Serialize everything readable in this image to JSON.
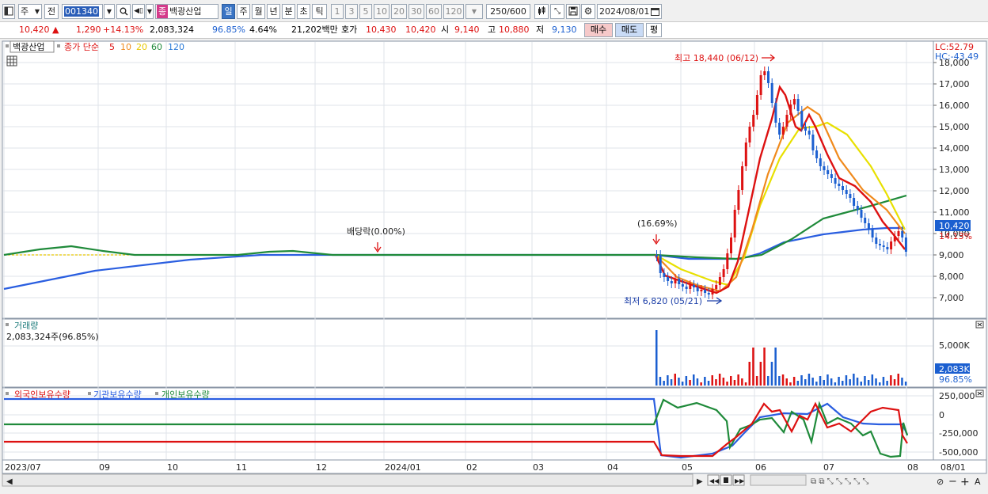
{
  "toolbar": {
    "period_tab": "주",
    "prev_label": "전",
    "stock_code": "001340",
    "stock_name": "백광산업",
    "name_badge": "종",
    "period_buttons": [
      "일",
      "주",
      "월",
      "년",
      "분",
      "초",
      "틱"
    ],
    "interval_buttons": [
      "1",
      "3",
      "5",
      "10",
      "20",
      "30",
      "60",
      "120"
    ],
    "count_display": "250",
    "count_max": "/600",
    "date_value": "2024/08/01"
  },
  "quote": {
    "price": "10,420",
    "arrow": "▲",
    "change": "1,290",
    "change_pct": "+14.13%",
    "volume": "2,083,324",
    "volume_ratio": "96.85%",
    "turnover": "4.64%",
    "amount": "21,202백만",
    "ask_label": "호가",
    "ask": "10,430",
    "bid": "10,420",
    "open_label": "시",
    "open": "9,140",
    "high_label": "고",
    "high": "10,880",
    "low_label": "저",
    "low": "9,130",
    "buy_label": "매수",
    "sell_label": "매도",
    "eval_label": "평"
  },
  "legend": {
    "name": "백광산업",
    "ma_label": "종가 단순",
    "ma": [
      {
        "p": "5",
        "color": "#dd1111"
      },
      {
        "p": "10",
        "color": "#f08a1c"
      },
      {
        "p": "20",
        "color": "#e8e000"
      },
      {
        "p": "60",
        "color": "#1f8a3a"
      },
      {
        "p": "120",
        "color": "#2a7ad8"
      }
    ]
  },
  "price_panel": {
    "lc": "LC:52.79",
    "hc": "HC:-43.49",
    "y_ticks": [
      "18,000",
      "17,000",
      "16,000",
      "15,000",
      "14,000",
      "13,000",
      "12,000",
      "11,000",
      "10,000",
      "9,000",
      "8,000",
      "7,000"
    ],
    "high_note": "최고 18,440 (06/12)",
    "low_note": "최저 6,820 (05/21)",
    "ex_div_note": "배당락(0.00%)",
    "ex_note2": "(16.69%)",
    "last_price": "10,420",
    "last_pct": "14.13%"
  },
  "volume_panel": {
    "title": "거래량",
    "value": "2,083,324주(96.85%)",
    "y_ticks": [
      "5,000K"
    ],
    "last": "2,083K",
    "last_pct": "96.85%"
  },
  "flow_panel": {
    "labels": [
      "외국인보유수량",
      "기관보유수량",
      "개인보유수량"
    ],
    "y_ticks": [
      "250,000",
      "0",
      "-250,000",
      "-500,000"
    ]
  },
  "x_axis": [
    "2023/07",
    "09",
    "10",
    "11",
    "12",
    "2024/01",
    "02",
    "03",
    "04",
    "05",
    "06",
    "07",
    "08",
    "08/01"
  ],
  "colors": {
    "ma5": "#dd1111",
    "ma10": "#f08a1c",
    "ma20": "#e8e000",
    "ma60": "#1f8a3a",
    "ma120": "#2a7ad8",
    "up": "#dd1111",
    "down": "#1b5fd0",
    "label_box": "#1b5fd0"
  }
}
